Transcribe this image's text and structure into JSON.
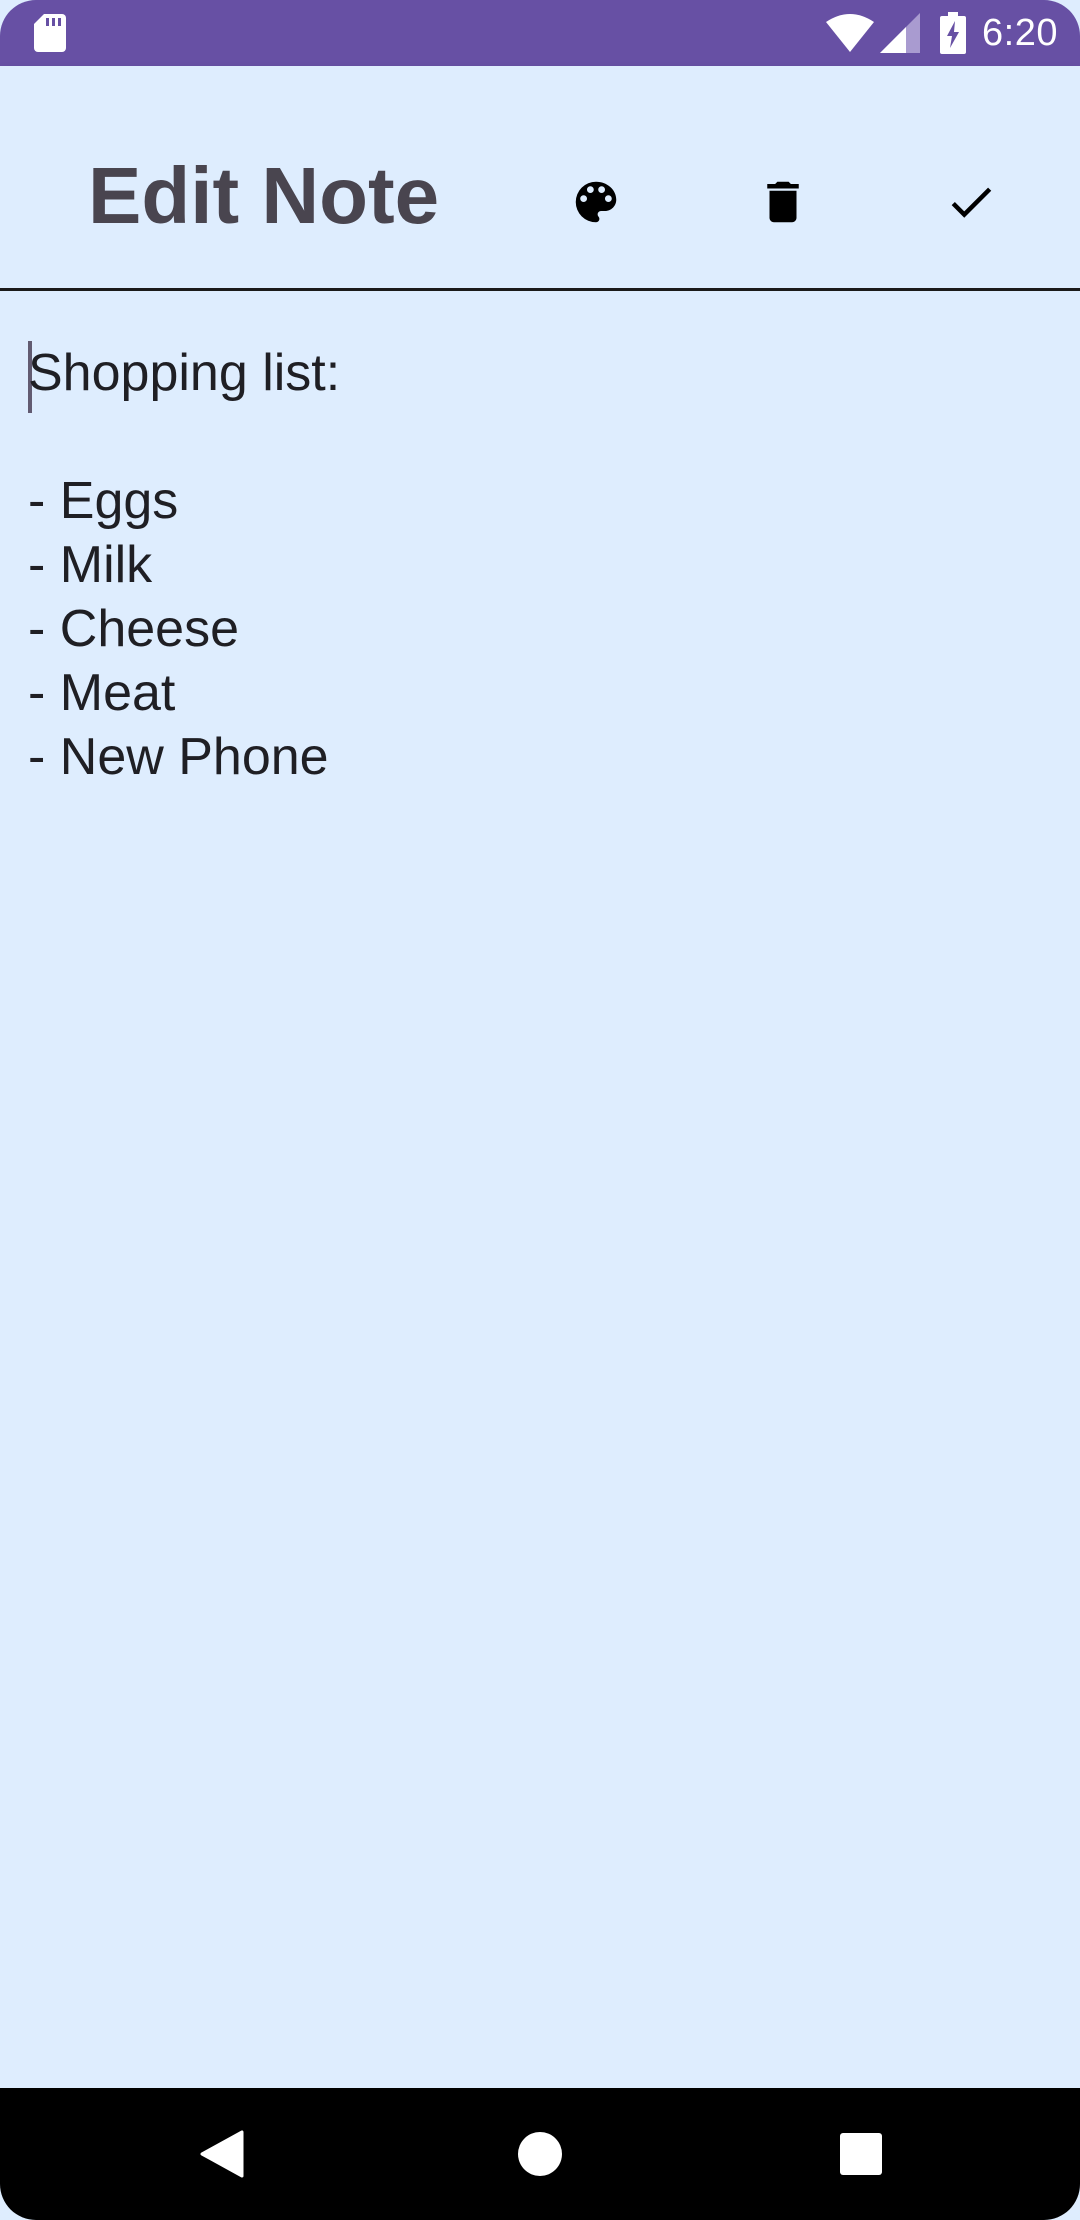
{
  "status_bar": {
    "time": "6:20",
    "icons": [
      "sd-card-icon",
      "wifi-icon",
      "cell-signal-icon",
      "battery-charging-icon"
    ],
    "color": "#6750a4"
  },
  "app_bar": {
    "title": "Edit Note",
    "actions": [
      {
        "name": "palette-icon",
        "purpose": "change color"
      },
      {
        "name": "delete-icon",
        "purpose": "delete note"
      },
      {
        "name": "check-icon",
        "purpose": "save note"
      }
    ]
  },
  "editor": {
    "content": "Shopping list:\n\n- Eggs\n- Milk\n- Cheese\n- Meat\n- New Phone",
    "background": "#deedfe"
  },
  "nav_bar": {
    "icons": [
      "back-icon",
      "home-icon",
      "recents-icon"
    ]
  }
}
